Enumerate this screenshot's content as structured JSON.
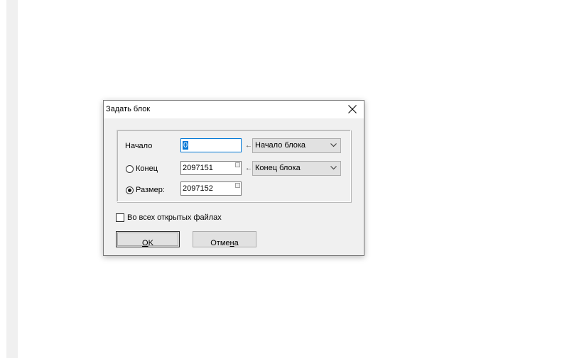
{
  "dialog": {
    "title": "Задать блок",
    "close_label": "×"
  },
  "start": {
    "label": "Начало",
    "value": "0",
    "arrow": "←",
    "combo_value": "Начало блока"
  },
  "end": {
    "label": "Конец",
    "value": "2097151",
    "arrow": "←",
    "combo_value": "Конец блока",
    "selected": false
  },
  "size": {
    "label": "Размер:",
    "value": "2097152",
    "selected": true
  },
  "all_files": {
    "label": "Во всех открытых файлах",
    "checked": false
  },
  "buttons": {
    "ok_prefix": "",
    "ok_mnemonic": "O",
    "ok_suffix": "K",
    "cancel_prefix": "Отме",
    "cancel_mnemonic": "н",
    "cancel_suffix": "а"
  }
}
